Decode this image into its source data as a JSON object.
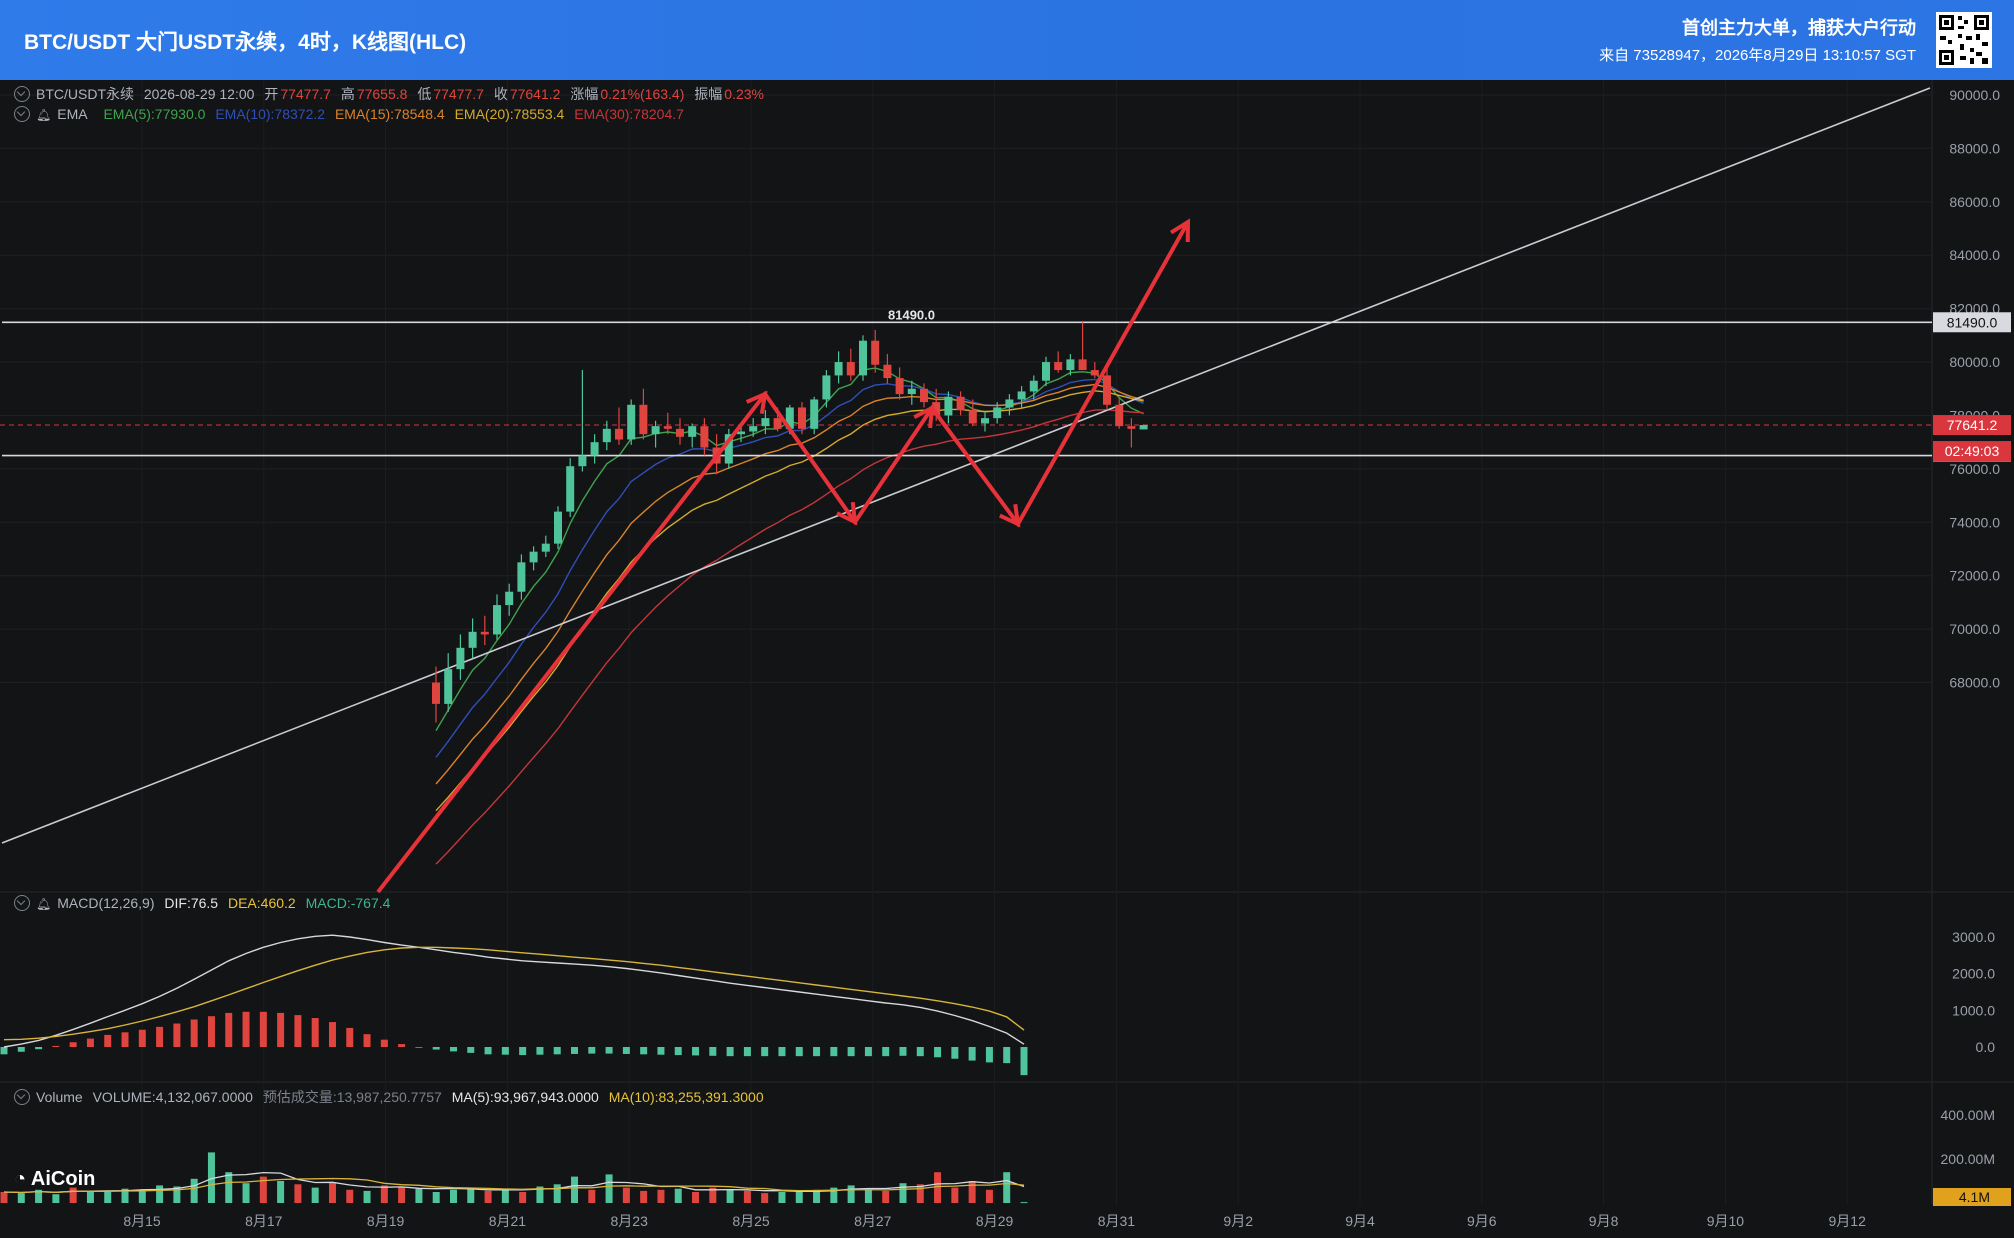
{
  "header": {
    "title": "BTC/USDT 大门USDT永续，4时，K线图(HLC)",
    "slogan": "首创主力大单，捕获大户行动",
    "source": "来自 73528947，2026年8月29日 13:10:57 SGT"
  },
  "ohlc_legend": {
    "symbol": "BTC/USDT永续",
    "time": "2026-08-29 12:00",
    "open_label": "开",
    "open": "77477.7",
    "high_label": "高",
    "high": "77655.8",
    "low_label": "低",
    "low": "77477.7",
    "close_label": "收",
    "close": "77641.2",
    "change_label": "涨幅",
    "change": "0.21%(163.4)",
    "amp_label": "振幅",
    "amp": "0.23%"
  },
  "ema_legend": {
    "name": "EMA",
    "items": [
      {
        "text": "EMA(5):77930.0",
        "color": "#3fa34d"
      },
      {
        "text": "EMA(10):78372.2",
        "color": "#2f4fb8"
      },
      {
        "text": "EMA(15):78548.4",
        "color": "#d9832b"
      },
      {
        "text": "EMA(20):78553.4",
        "color": "#d4ac2a"
      },
      {
        "text": "EMA(30):78204.7",
        "color": "#c4363a"
      }
    ]
  },
  "macd_legend": {
    "name": "MACD(12,26,9)",
    "dif": "DIF:76.5",
    "dea": "DEA:460.2",
    "macd": "MACD:-767.4"
  },
  "volume_legend": {
    "name": "Volume",
    "volume": "VOLUME:4,132,067.0000",
    "est": "预估成交量:13,987,250.7757",
    "ma5": "MA(5):93,967,943.0000",
    "ma10": "MA(10):83,255,391.3000"
  },
  "price_axis": [
    "90000.0",
    "88000.0",
    "86000.0",
    "84000.0",
    "82000.0",
    "80000.0",
    "78000.0",
    "76000.0",
    "74000.0",
    "72000.0",
    "70000.0",
    "68000.0"
  ],
  "price_tags": {
    "level": "81490.0",
    "last": "77641.2",
    "countdown": "02:49:03"
  },
  "macd_axis": [
    "3000.0",
    "2000.0",
    "1000.0",
    "0.0"
  ],
  "volume_axis": [
    "400.00M",
    "200.00M"
  ],
  "volume_tag": "4.1M",
  "date_axis": [
    "8月15",
    "8月17",
    "8月19",
    "8月21",
    "8月23",
    "8月25",
    "8月27",
    "8月29",
    "8月31",
    "9月2",
    "9月4",
    "9月6",
    "9月8",
    "9月10",
    "9月12"
  ],
  "logo": "AiCoin",
  "colors": {
    "up": "#4fc39a",
    "down": "#e0443e",
    "tag": "#d9363e"
  },
  "chart_data": {
    "type": "candlestick",
    "ylim": [
      66000,
      90500
    ],
    "horizontal_levels": [
      81490,
      76500
    ],
    "last_price": 77641.2,
    "annotation_label": "81490.0",
    "candles_x_start": "2026-08-20 08:00",
    "candle_interval": "4h",
    "candles": [
      [
        68000,
        68600,
        66500,
        67200
      ],
      [
        67200,
        69100,
        66900,
        68500
      ],
      [
        68500,
        69800,
        68100,
        69300
      ],
      [
        69300,
        70400,
        68900,
        69900
      ],
      [
        69900,
        70500,
        69400,
        69800
      ],
      [
        69800,
        71300,
        69600,
        70900
      ],
      [
        70900,
        71700,
        70500,
        71400
      ],
      [
        71400,
        72800,
        71100,
        72500
      ],
      [
        72500,
        73100,
        72200,
        72900
      ],
      [
        72900,
        73500,
        72700,
        73200
      ],
      [
        73200,
        74600,
        73000,
        74400
      ],
      [
        74400,
        76400,
        74200,
        76100
      ],
      [
        76100,
        79700,
        75900,
        76500
      ],
      [
        76500,
        77300,
        76200,
        77000
      ],
      [
        77000,
        77800,
        76700,
        77500
      ],
      [
        77500,
        78300,
        76900,
        77100
      ],
      [
        77100,
        78600,
        76900,
        78400
      ],
      [
        78400,
        79000,
        77100,
        77300
      ],
      [
        77300,
        77800,
        76800,
        77600
      ],
      [
        77600,
        78100,
        77300,
        77500
      ],
      [
        77500,
        77900,
        76900,
        77200
      ],
      [
        77200,
        77700,
        76800,
        77600
      ],
      [
        77600,
        77900,
        76500,
        76800
      ],
      [
        76800,
        77300,
        75800,
        76200
      ],
      [
        76200,
        77500,
        76000,
        77300
      ],
      [
        77300,
        77700,
        77000,
        77400
      ],
      [
        77400,
        77900,
        77200,
        77600
      ],
      [
        77600,
        78200,
        77300,
        77900
      ],
      [
        77900,
        78300,
        77400,
        77500
      ],
      [
        77500,
        78400,
        77300,
        78300
      ],
      [
        78300,
        78500,
        77300,
        77500
      ],
      [
        77500,
        78700,
        77300,
        78600
      ],
      [
        78600,
        79700,
        78300,
        79500
      ],
      [
        79500,
        80400,
        79200,
        80000
      ],
      [
        80000,
        80500,
        79300,
        79500
      ],
      [
        79500,
        81000,
        79300,
        80800
      ],
      [
        80800,
        81200,
        79600,
        79900
      ],
      [
        79900,
        80300,
        79200,
        79400
      ],
      [
        79400,
        79800,
        78600,
        78800
      ],
      [
        78800,
        79300,
        78400,
        79000
      ],
      [
        79000,
        79200,
        78300,
        78500
      ],
      [
        78500,
        79000,
        77800,
        78000
      ],
      [
        78000,
        78900,
        77700,
        78700
      ],
      [
        78700,
        78900,
        78000,
        78200
      ],
      [
        78200,
        78600,
        77600,
        77700
      ],
      [
        77700,
        78100,
        77400,
        77900
      ],
      [
        77900,
        78500,
        77700,
        78300
      ],
      [
        78300,
        78800,
        78000,
        78600
      ],
      [
        78600,
        79100,
        78300,
        78900
      ],
      [
        78900,
        79500,
        78600,
        79300
      ],
      [
        79300,
        80200,
        79100,
        80000
      ],
      [
        80000,
        80400,
        79600,
        79700
      ],
      [
        79700,
        80300,
        79500,
        80100
      ],
      [
        80100,
        81490,
        79900,
        79700
      ],
      [
        79700,
        80000,
        79400,
        79500
      ],
      [
        79500,
        79800,
        78200,
        78400
      ],
      [
        78400,
        78700,
        77500,
        77600
      ],
      [
        77600,
        77900,
        76800,
        77500
      ],
      [
        77477.7,
        77655.8,
        77477.7,
        77641.2
      ]
    ],
    "macd": {
      "dif": [
        0,
        80,
        180,
        320,
        480,
        650,
        830,
        1000,
        1180,
        1380,
        1600,
        1850,
        2100,
        2350,
        2550,
        2720,
        2850,
        2950,
        3020,
        3050,
        3000,
        2930,
        2850,
        2780,
        2720,
        2650,
        2580,
        2520,
        2450,
        2400,
        2350,
        2320,
        2290,
        2260,
        2230,
        2190,
        2140,
        2080,
        2020,
        1950,
        1880,
        1810,
        1740,
        1680,
        1620,
        1560,
        1500,
        1440,
        1380,
        1320,
        1260,
        1200,
        1150,
        1080,
        980,
        860,
        720,
        560,
        380,
        76.5
      ],
      "dea": [
        200,
        210,
        240,
        290,
        350,
        420,
        500,
        600,
        710,
        830,
        960,
        1100,
        1260,
        1420,
        1590,
        1760,
        1920,
        2080,
        2230,
        2370,
        2480,
        2580,
        2650,
        2700,
        2720,
        2720,
        2700,
        2680,
        2650,
        2610,
        2570,
        2530,
        2490,
        2450,
        2410,
        2370,
        2330,
        2280,
        2230,
        2170,
        2110,
        2050,
        1990,
        1930,
        1870,
        1810,
        1750,
        1690,
        1630,
        1570,
        1510,
        1450,
        1390,
        1330,
        1260,
        1180,
        1090,
        980,
        820,
        460.2
      ],
      "hist": [
        -200,
        -130,
        -60,
        30,
        130,
        230,
        330,
        400,
        470,
        550,
        640,
        750,
        840,
        930,
        960,
        960,
        930,
        870,
        790,
        680,
        520,
        350,
        200,
        80,
        0,
        -70,
        -120,
        -160,
        -200,
        -210,
        -220,
        -210,
        -200,
        -190,
        -180,
        -180,
        -190,
        -200,
        -210,
        -220,
        -230,
        -240,
        -250,
        -250,
        -250,
        -250,
        -250,
        -250,
        -250,
        -250,
        -250,
        -250,
        -240,
        -250,
        -280,
        -320,
        -370,
        -420,
        -440,
        -767.4
      ]
    },
    "volume": {
      "bars": [
        50,
        45,
        60,
        40,
        70,
        55,
        50,
        65,
        60,
        80,
        75,
        110,
        230,
        140,
        90,
        120,
        100,
        85,
        70,
        95,
        60,
        55,
        80,
        75,
        65,
        50,
        60,
        70,
        55,
        65,
        50,
        75,
        85,
        120,
        60,
        130,
        70,
        55,
        60,
        65,
        50,
        70,
        60,
        55,
        45,
        50,
        55,
        60,
        70,
        80,
        65,
        55,
        90,
        85,
        140,
        70,
        100,
        60,
        140,
        4.1
      ],
      "ylim": [
        0,
        450
      ]
    }
  }
}
